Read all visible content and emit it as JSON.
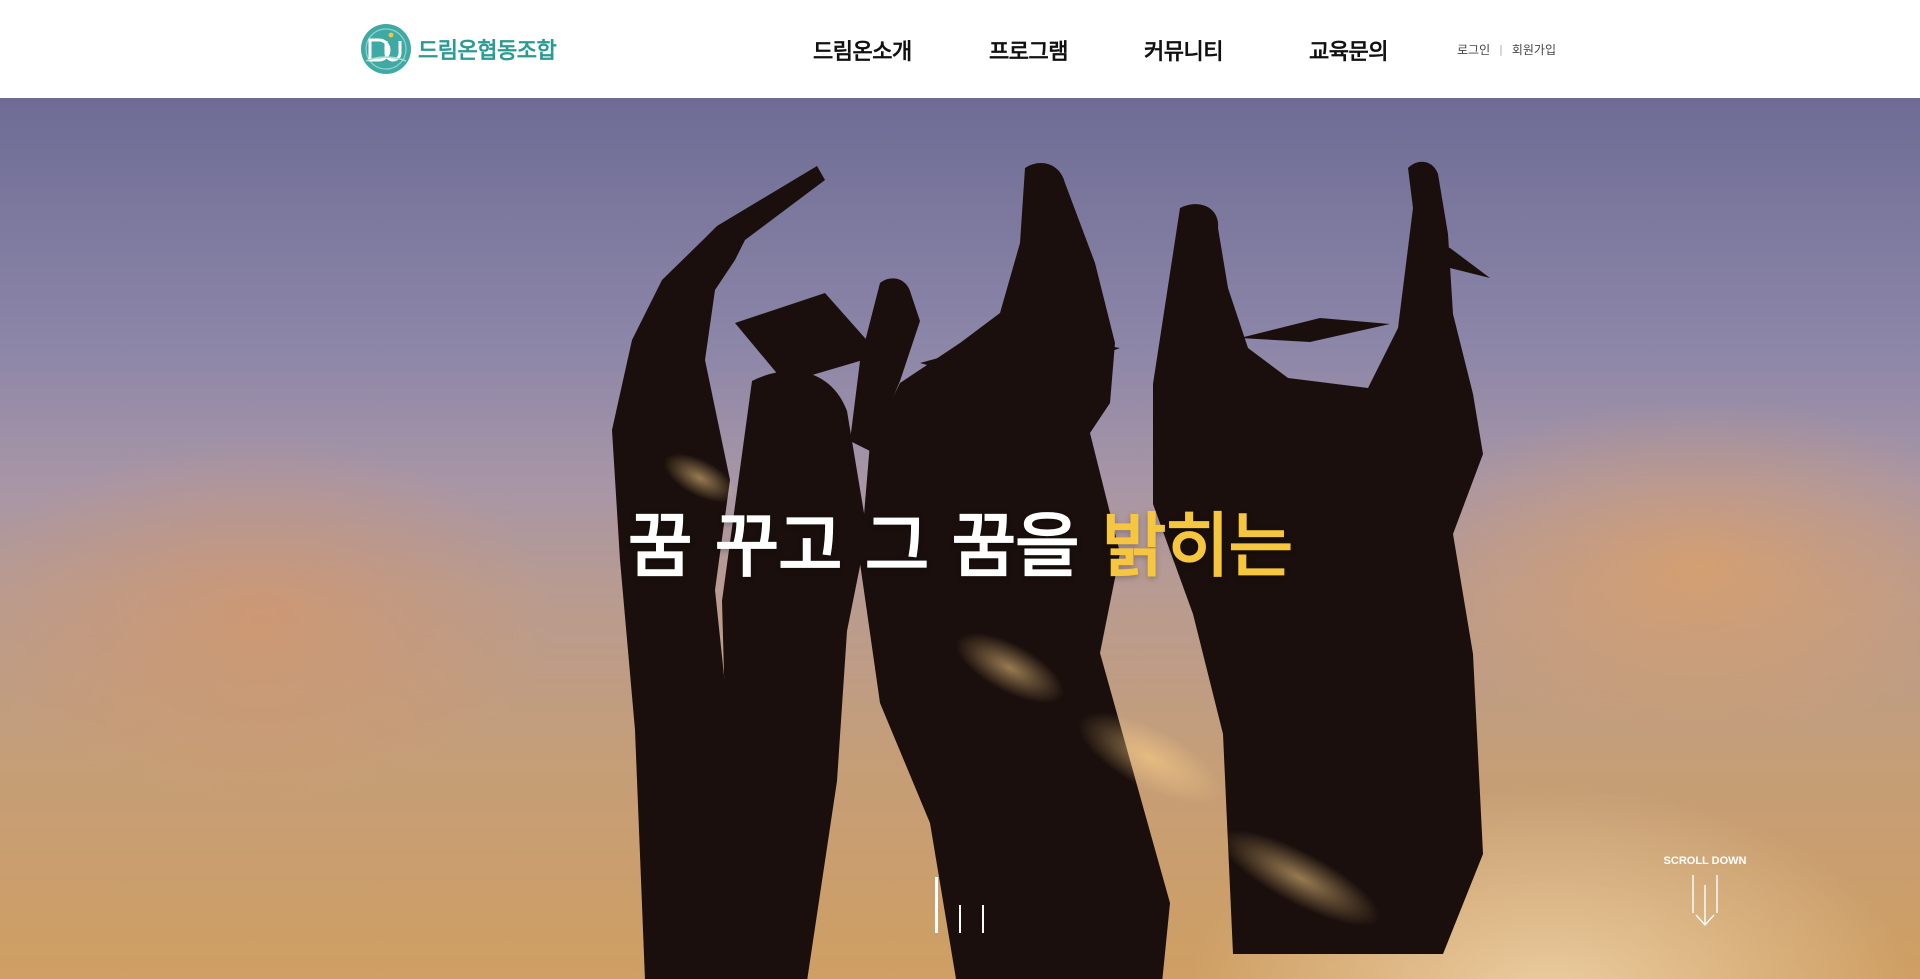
{
  "header": {
    "logo_text": "드림온협동조합",
    "logo_mark_icon": "dream-on-logo-icon",
    "nav": [
      {
        "label": "드림온소개"
      },
      {
        "label": "프로그램"
      },
      {
        "label": "커뮤니티"
      },
      {
        "label": "교육문의"
      }
    ],
    "util": {
      "login": "로그인",
      "separator": "|",
      "signup": "회원가입"
    }
  },
  "hero": {
    "title_main": "꿈 꾸고 그 꿈을 ",
    "title_accent": "밝히는",
    "accent_color": "#f6c63e",
    "background_image": "graduates-silhouette-sunset",
    "slides": {
      "count": 3,
      "active": 1
    },
    "scroll_down_label": "SCROLL DOWN",
    "scroll_down_icon": "arrow-down-icon"
  },
  "colors": {
    "brand": "#2a9a95",
    "nav_text": "#111111",
    "hero_text": "#ffffff"
  }
}
